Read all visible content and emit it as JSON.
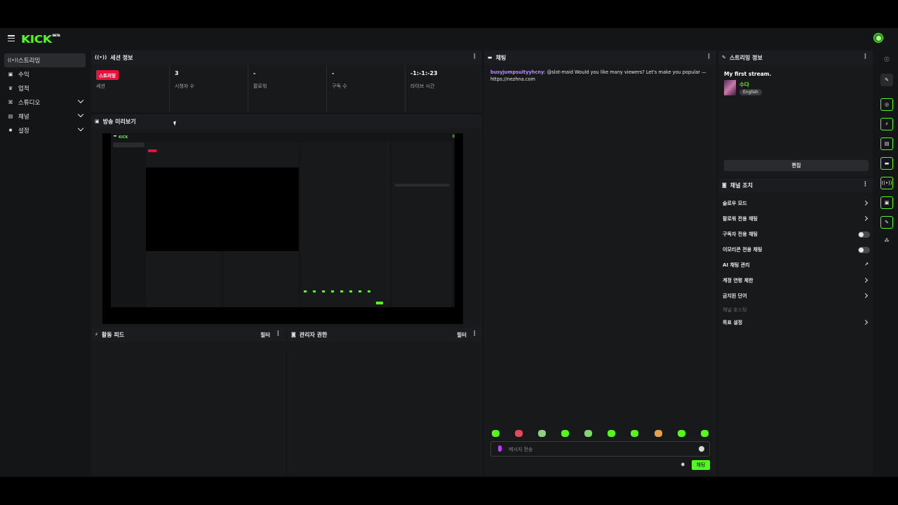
{
  "brand": {
    "logo": "KICK",
    "logo_sup": "BETA",
    "accent": "#53fc18"
  },
  "sidebar": {
    "items": [
      {
        "label": "스트리밍",
        "icon": "broadcast-icon",
        "active": true
      },
      {
        "label": "수익",
        "icon": "wallet-icon"
      },
      {
        "label": "업적",
        "icon": "trophy-icon"
      },
      {
        "label": "스튜디오",
        "icon": "studio-icon",
        "expandable": true
      },
      {
        "label": "채널",
        "icon": "channel-icon",
        "expandable": true
      },
      {
        "label": "설정",
        "icon": "gear-icon",
        "expandable": true
      }
    ]
  },
  "session": {
    "title": "세션 정보",
    "stats": [
      {
        "value": "스트리밍",
        "label": "세션",
        "badge": true
      },
      {
        "value": "3",
        "label": "시청자 수"
      },
      {
        "value": "-",
        "label": "팔로워"
      },
      {
        "value": "-",
        "label": "구독 수"
      },
      {
        "value": "-1:-1:-23",
        "label": "라이브 시간"
      }
    ]
  },
  "preview": {
    "title": "방송 미리보기"
  },
  "activity": {
    "title": "활동 피드",
    "filter": "필터"
  },
  "moderator": {
    "title": "관리자 권한",
    "filter": "필터"
  },
  "chat": {
    "title": "채팅",
    "message_user": "busyjumpsuityyhcny",
    "message_text": ": @slot-maid Would you like many viewers? Let's make you popular — https://nezhna.com",
    "input_placeholder": "메시지 전송",
    "send_label": "채팅"
  },
  "stream_info": {
    "title": "스트리밍 정보",
    "stream_title": "My first stream.",
    "category": "수다",
    "language": "English",
    "edit_label": "편집"
  },
  "channel_controls": {
    "title": "채널 조치",
    "rows": [
      {
        "label": "슬로우 모드",
        "control": "arrow"
      },
      {
        "label": "팔로워 전용 채팅",
        "control": "arrow"
      },
      {
        "label": "구독자 전용 채팅",
        "control": "toggle"
      },
      {
        "label": "이모티콘 전용 채팅",
        "control": "toggle"
      },
      {
        "label": "AI 채팅 관리",
        "control": "external"
      },
      {
        "label": "계정 연령 제한",
        "control": "arrow"
      },
      {
        "label": "금지된 단어",
        "control": "arrow"
      },
      {
        "label": "채널 호스팅",
        "control": "none",
        "disabled": true
      },
      {
        "label": "목표 설정",
        "control": "arrow"
      }
    ]
  }
}
